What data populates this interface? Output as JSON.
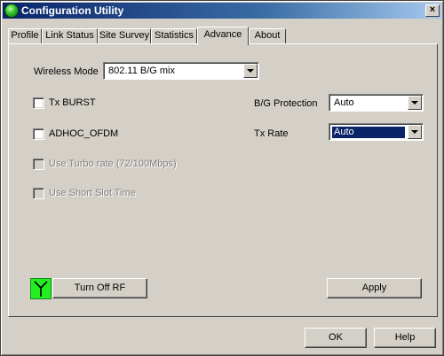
{
  "window": {
    "title": "Configuration Utility",
    "close_glyph": "×",
    "icon": "green-orb-icon",
    "accent": "#0a246a"
  },
  "tabs": [
    {
      "label": "Profile"
    },
    {
      "label": "Link Status"
    },
    {
      "label": "Site Survey"
    },
    {
      "label": "Statistics"
    },
    {
      "label": "Advance",
      "active": true
    },
    {
      "label": "About"
    }
  ],
  "advance": {
    "wireless_mode": {
      "label": "Wireless Mode",
      "value": "802.11 B/G mix"
    },
    "tx_burst": {
      "label": "Tx BURST",
      "checked": false
    },
    "adhoc_ofdm": {
      "label": "ADHOC_OFDM",
      "checked": false
    },
    "turbo_rate": {
      "label": "Use Turbo rate (72/100Mbps)",
      "checked": false,
      "enabled": false
    },
    "short_slot": {
      "label": "Use Short Slot Time",
      "checked": false,
      "enabled": false
    },
    "bg_protection": {
      "label": "B/G Protection",
      "value": "Auto"
    },
    "tx_rate": {
      "label": "Tx Rate",
      "value": "Auto"
    },
    "rf_button": {
      "label": "Turn Off RF",
      "indicator_color": "#22ee22",
      "icon": "antenna-icon"
    },
    "apply_button": {
      "label": "Apply"
    }
  },
  "footer": {
    "ok_label": "OK",
    "help_label": "Help"
  }
}
